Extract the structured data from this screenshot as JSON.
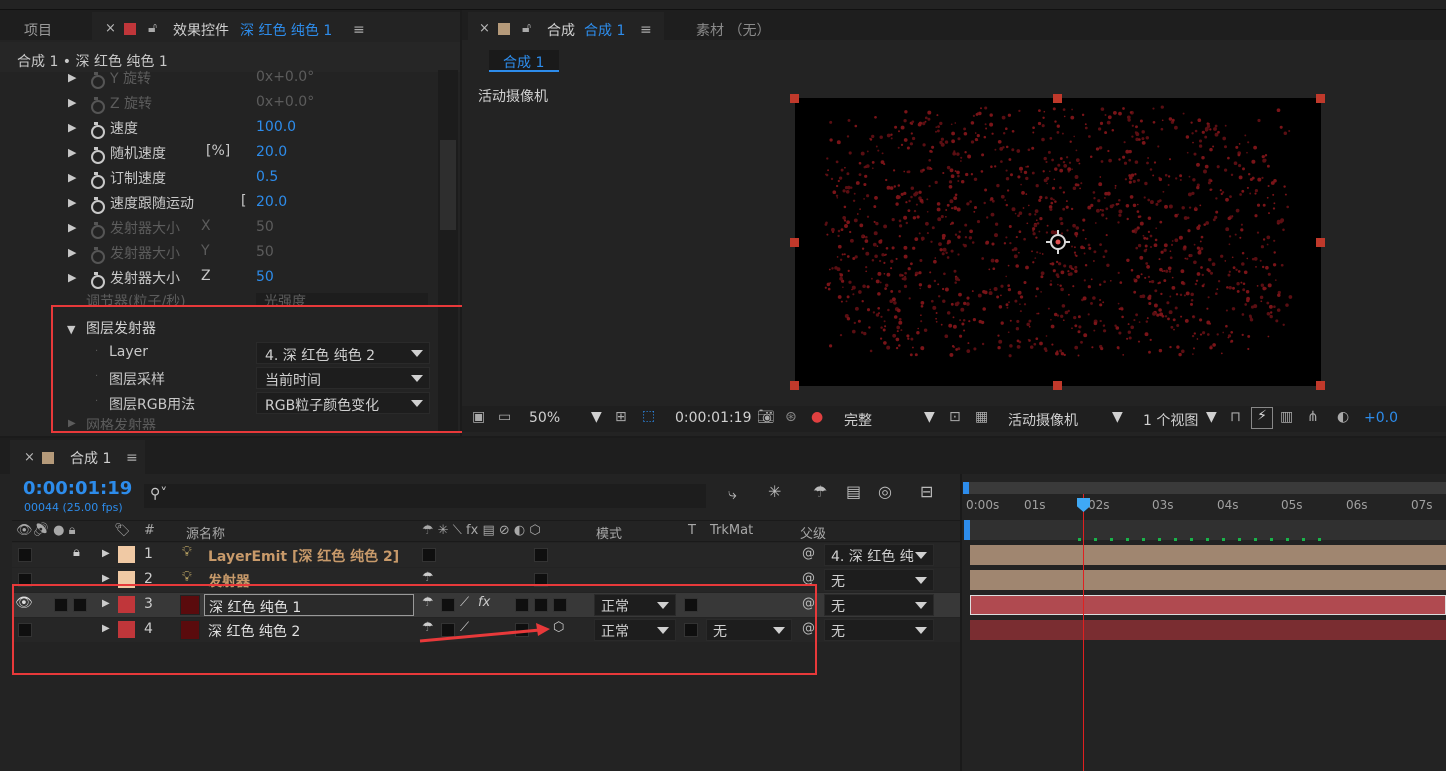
{
  "top_tabs": {
    "project": "项目",
    "effects_label": "效果控件",
    "effects_target": "深 红色 纯色 1",
    "comp_label": "合成",
    "comp_name": "合成 1",
    "footage": "素材 （无）"
  },
  "effects": {
    "breadcrumb": "合成 1 • 深 红色 纯色 1",
    "rows": [
      {
        "label": "Y 旋转",
        "value": "0x+0.0°",
        "dim": true
      },
      {
        "label": "Z 旋转",
        "value": "0x+0.0°",
        "dim": true
      },
      {
        "label": "速度",
        "value": "100.0",
        "dim": false
      },
      {
        "label": "随机速度",
        "extra": "[%]",
        "value": "20.0",
        "dim": false
      },
      {
        "label": "订制速度",
        "value": "0.5",
        "dim": false
      },
      {
        "label": "速度跟随运动",
        "extra": "[",
        "value": "20.0",
        "dim": false
      },
      {
        "label": "发射器大小",
        "extra": "X",
        "value": "50",
        "dim": true
      },
      {
        "label": "发射器大小",
        "extra": "Y",
        "value": "50",
        "dim": true
      },
      {
        "label": "发射器大小",
        "extra": "Z",
        "value": "50",
        "dim": false
      }
    ],
    "partial_row": {
      "label": "调节器(粒子/秒)",
      "value": "光强度"
    },
    "layer_emitter": {
      "section_title": "图层发射器",
      "fields": [
        {
          "label": "Layer",
          "value": "4. 深 红色 纯色 2"
        },
        {
          "label": "图层采样",
          "value": "当前时间"
        },
        {
          "label": "图层RGB用法",
          "value": "RGB粒子颜色变化"
        }
      ]
    },
    "next_section": "网格发射器"
  },
  "comp_viewer": {
    "tab_chip": "合成 1",
    "camera_label": "活动摄像机",
    "toolbar": {
      "zoom": "50%",
      "timecode": "0:00:01:19",
      "resolution": "完整",
      "camera": "活动摄像机",
      "views": "1 个视图",
      "exposure": "+0.0"
    }
  },
  "timeline": {
    "tab": "合成 1",
    "timecode": "0:00:01:19",
    "frames": "00044 (25.00 fps)",
    "columns": {
      "num": "#",
      "source": "源名称",
      "mode": "模式",
      "t": "T",
      "trkmat": "TrkMat",
      "parent": "父级"
    },
    "ruler": [
      "0:00s",
      "01s",
      "02s",
      "03s",
      "04s",
      "05s",
      "06s",
      "07s"
    ],
    "layers": [
      {
        "num": "1",
        "name": "LayerEmit [深 红色 纯色 2]",
        "mode": "",
        "trkmat": "",
        "parent": "4. 深 红色 纯"
      },
      {
        "num": "2",
        "name": "发射器",
        "mode": "",
        "trkmat": "",
        "parent": "无"
      },
      {
        "num": "3",
        "name": "深 红色 纯色 1",
        "mode": "正常",
        "trkmat": "",
        "parent": "无"
      },
      {
        "num": "4",
        "name": "深 红色 纯色 2",
        "mode": "正常",
        "trkmat": "无",
        "parent": "无"
      }
    ]
  },
  "colors": {
    "accent": "#2d8ceb",
    "annotation": "#e8393a",
    "solid": "#c0363a"
  }
}
